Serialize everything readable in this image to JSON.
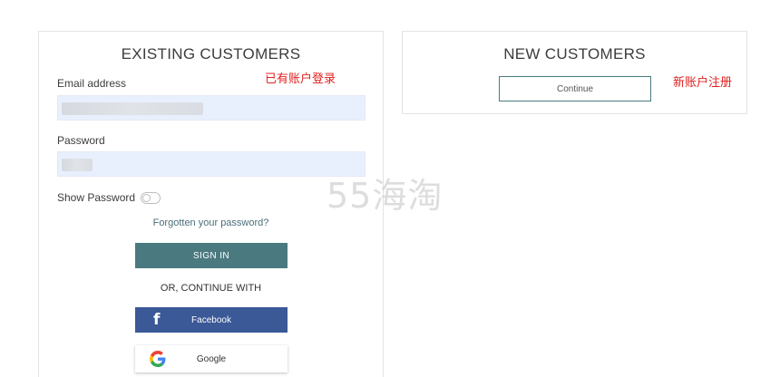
{
  "existing": {
    "title": "EXISTING CUSTOMERS",
    "cn_note": "已有账户登录",
    "email_label": "Email address",
    "password_label": "Password",
    "show_password_label": "Show Password",
    "forgot_link": "Forgotten your password?",
    "sign_in_label": "SIGN IN",
    "or_text": "OR, CONTINUE WITH",
    "facebook_label": "Facebook",
    "google_label": "Google"
  },
  "new_customers": {
    "title": "NEW CUSTOMERS",
    "cn_note": "新账户注册",
    "continue_label": "Continue"
  },
  "watermark": "55海淘",
  "colors": {
    "accent": "#4a7a80",
    "facebook": "#3b5897",
    "note_red": "#e02020",
    "field_bg": "#e8f0fe"
  },
  "icons": {
    "facebook": "facebook-icon",
    "google": "google-icon"
  }
}
